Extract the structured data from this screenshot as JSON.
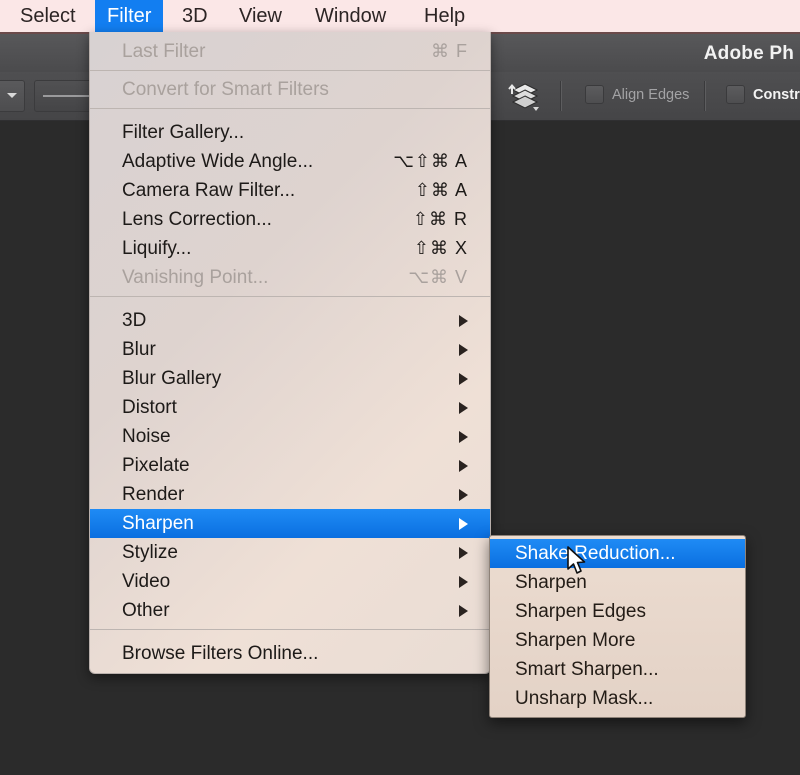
{
  "menubar": {
    "items": [
      {
        "label": "Select",
        "active": false
      },
      {
        "label": "Filter",
        "active": true
      },
      {
        "label": "3D",
        "active": false
      },
      {
        "label": "View",
        "active": false
      },
      {
        "label": "Window",
        "active": false
      },
      {
        "label": "Help",
        "active": false
      }
    ],
    "background_color": "#fbe7e7",
    "highlight_color": "#127ef1"
  },
  "titlebar": {
    "title": "Adobe Ph"
  },
  "options_bar": {
    "align_edges_label": "Align Edges",
    "constrain_label": "Constr",
    "layers_icon": "layers-icon"
  },
  "filter_menu": {
    "groups": [
      [
        {
          "label": "Last Filter",
          "shortcut": "⌘ F",
          "disabled": true,
          "submenu": false
        },
        {
          "label": "Convert for Smart Filters",
          "shortcut": "",
          "disabled": true,
          "submenu": false
        }
      ],
      [
        {
          "label": "Filter Gallery...",
          "shortcut": "",
          "disabled": false,
          "submenu": false
        },
        {
          "label": "Adaptive Wide Angle...",
          "shortcut": "⌥⇧⌘ A",
          "disabled": false,
          "submenu": false
        },
        {
          "label": "Camera Raw Filter...",
          "shortcut": "⇧⌘ A",
          "disabled": false,
          "submenu": false
        },
        {
          "label": "Lens Correction...",
          "shortcut": "⇧⌘ R",
          "disabled": false,
          "submenu": false
        },
        {
          "label": "Liquify...",
          "shortcut": "⇧⌘ X",
          "disabled": false,
          "submenu": false
        },
        {
          "label": "Vanishing Point...",
          "shortcut": "⌥⌘ V",
          "disabled": true,
          "submenu": false
        }
      ],
      [
        {
          "label": "3D",
          "shortcut": "",
          "disabled": false,
          "submenu": true
        },
        {
          "label": "Blur",
          "shortcut": "",
          "disabled": false,
          "submenu": true
        },
        {
          "label": "Blur Gallery",
          "shortcut": "",
          "disabled": false,
          "submenu": true
        },
        {
          "label": "Distort",
          "shortcut": "",
          "disabled": false,
          "submenu": true
        },
        {
          "label": "Noise",
          "shortcut": "",
          "disabled": false,
          "submenu": true
        },
        {
          "label": "Pixelate",
          "shortcut": "",
          "disabled": false,
          "submenu": true
        },
        {
          "label": "Render",
          "shortcut": "",
          "disabled": false,
          "submenu": true
        },
        {
          "label": "Sharpen",
          "shortcut": "",
          "disabled": false,
          "submenu": true,
          "highlighted": true
        },
        {
          "label": "Stylize",
          "shortcut": "",
          "disabled": false,
          "submenu": true
        },
        {
          "label": "Video",
          "shortcut": "",
          "disabled": false,
          "submenu": true
        },
        {
          "label": "Other",
          "shortcut": "",
          "disabled": false,
          "submenu": true
        }
      ],
      [
        {
          "label": "Browse Filters Online...",
          "shortcut": "",
          "disabled": false,
          "submenu": false
        }
      ]
    ]
  },
  "sharpen_submenu": {
    "items": [
      {
        "label": "Shake Reduction...",
        "highlighted": true
      },
      {
        "label": "Sharpen",
        "highlighted": false
      },
      {
        "label": "Sharpen Edges",
        "highlighted": false
      },
      {
        "label": "Sharpen More",
        "highlighted": false
      },
      {
        "label": "Smart Sharpen...",
        "highlighted": false
      },
      {
        "label": "Unsharp Mask...",
        "highlighted": false
      }
    ]
  }
}
